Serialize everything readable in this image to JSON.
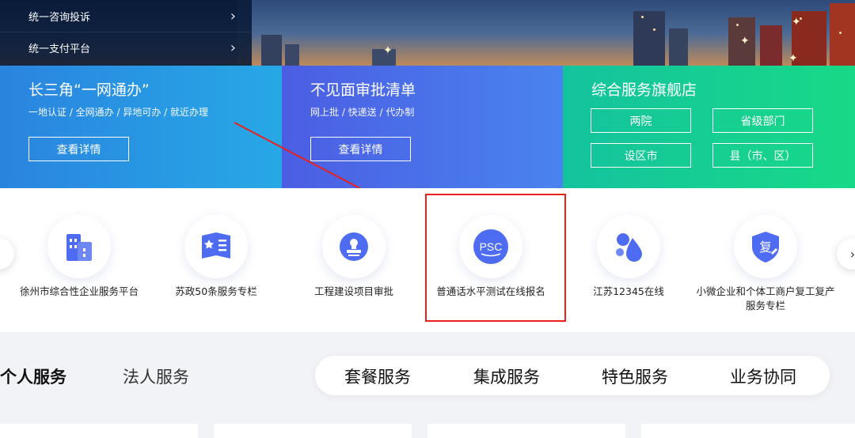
{
  "side_menu": [
    {
      "label": "统一咨询投诉",
      "chevron": "›"
    },
    {
      "label": "统一支付平台",
      "chevron": "›"
    }
  ],
  "cards": {
    "yangtze": {
      "title": "长三角“一网通办”",
      "subtitle": "一地认证 / 全网通办 / 异地可办 / 就近办理",
      "button": "查看详情",
      "color": "#27a8e6"
    },
    "approval": {
      "title": "不见面审批清单",
      "subtitle": "网上批 / 快递送 / 代办制",
      "button": "查看详情",
      "color": "#4a6ef0"
    },
    "flagship": {
      "title": "综合服务旗舰店",
      "buttons": [
        "两院",
        "省级部门",
        "设区市",
        "县（市、区）"
      ],
      "color": "#16cf92"
    }
  },
  "services": [
    {
      "label": "徐州市综合性企业服务平台",
      "icon": "building-icon"
    },
    {
      "label": "苏政50条服务专栏",
      "icon": "book-star-icon"
    },
    {
      "label": "工程建设项目审批",
      "icon": "stamp-icon"
    },
    {
      "label": "普通话水平测试在线报名",
      "icon": "psc-icon",
      "icon_text": "PSC",
      "highlighted": true
    },
    {
      "label": "江苏12345在线",
      "icon": "drops-icon"
    },
    {
      "label": "小微企业和个体工商户复工复产服务专栏",
      "icon": "shield-fu-icon",
      "icon_text": "复"
    }
  ],
  "carousel": {
    "prev": "‹",
    "next": "›"
  },
  "tabs": {
    "main": [
      {
        "label": "个人服务",
        "active": true
      },
      {
        "label": "法人服务",
        "active": false
      }
    ],
    "sub": [
      "套餐服务",
      "集成服务",
      "特色服务",
      "业务协同"
    ]
  },
  "colors": {
    "accent": "#4a63e6",
    "highlight": "#e8211c",
    "icon_blue": "#4e6cf2"
  }
}
